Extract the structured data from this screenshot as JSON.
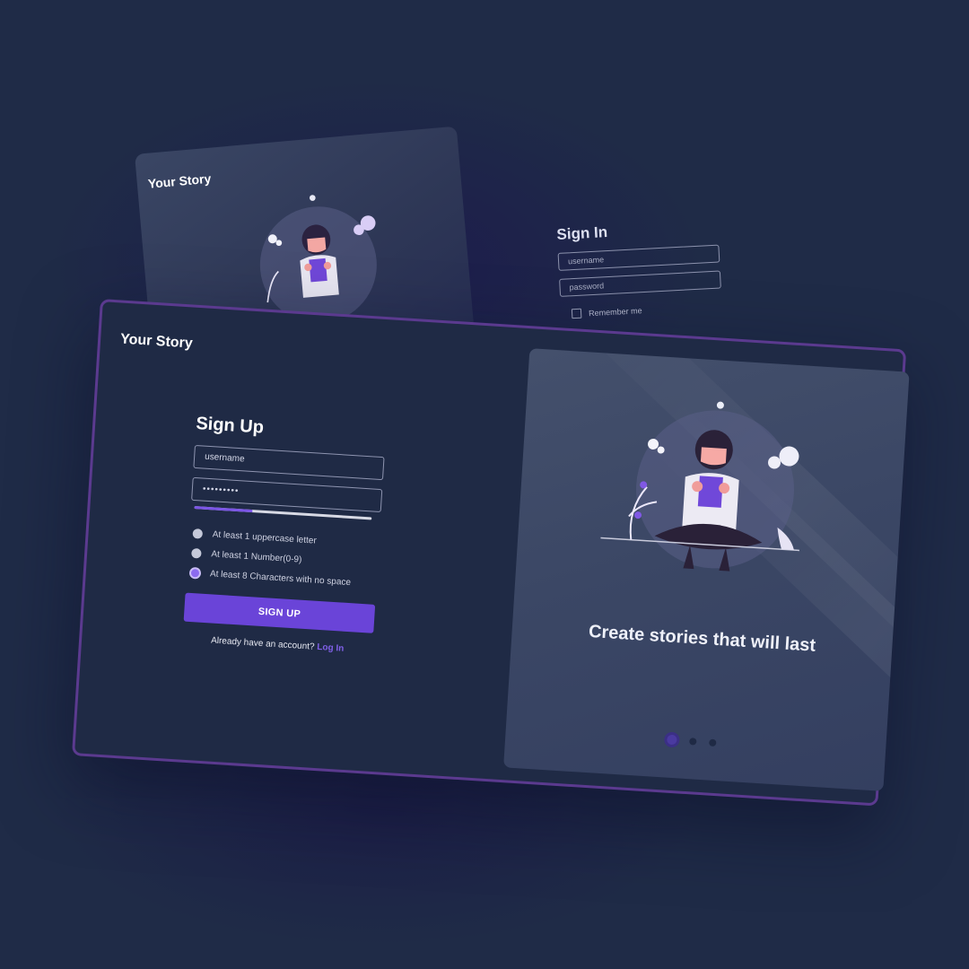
{
  "back_screen": {
    "logo": "Your Story",
    "signin": {
      "title": "Sign In",
      "username_placeholder": "username",
      "password_placeholder": "password",
      "remember_label": "Remember me"
    }
  },
  "main_screen": {
    "logo": "Your Story",
    "signup": {
      "title": "Sign Up",
      "username_placeholder": "username",
      "password_value": "•••••••••",
      "password_strength": 0.33,
      "rules": [
        {
          "text": "At least 1 uppercase letter",
          "met": false
        },
        {
          "text": "At least 1 Number(0-9)",
          "met": false
        },
        {
          "text": "At least 8 Characters with no space",
          "met": true
        }
      ],
      "button_label": "SIGN UP",
      "account_prompt": "Already have an account?",
      "login_link": "Log In"
    },
    "hero": {
      "caption": "Create stories that will last",
      "pages": 3,
      "active_page": 1
    }
  },
  "colors": {
    "background": "#1f2b47",
    "accent": "#6a44d8",
    "card_border": "#5b3a8f",
    "link": "#8060e8"
  },
  "icons": [
    "checkbox-icon",
    "requirement-dot-icon",
    "pager-dot-icon"
  ]
}
